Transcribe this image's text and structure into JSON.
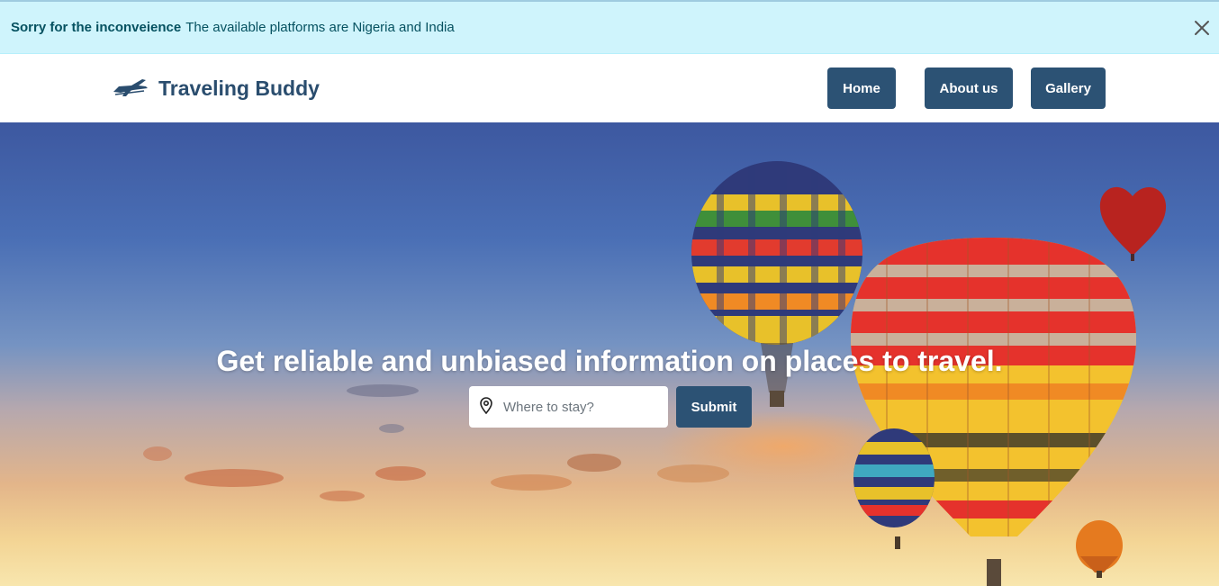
{
  "alert": {
    "strong_text": "Sorry for the inconveience",
    "message": "The available platforms are Nigeria and India",
    "close_icon": "close-icon"
  },
  "navbar": {
    "brand": "Traveling Buddy",
    "brand_icon": "airplane-icon",
    "links": [
      {
        "label": "Home"
      },
      {
        "label": "About us"
      },
      {
        "label": "Gallery"
      }
    ]
  },
  "hero": {
    "headline": "Get reliable and unbiased information on places to travel.",
    "search": {
      "icon": "location-pin-icon",
      "placeholder": "Where to stay?",
      "value": ""
    },
    "submit_label": "Submit",
    "background": "hot-air-balloons-sunset"
  },
  "colors": {
    "accent": "#2c5274",
    "alert_bg": "#cff4fc",
    "alert_text": "#055160",
    "brand_text": "#2a4d6e"
  }
}
